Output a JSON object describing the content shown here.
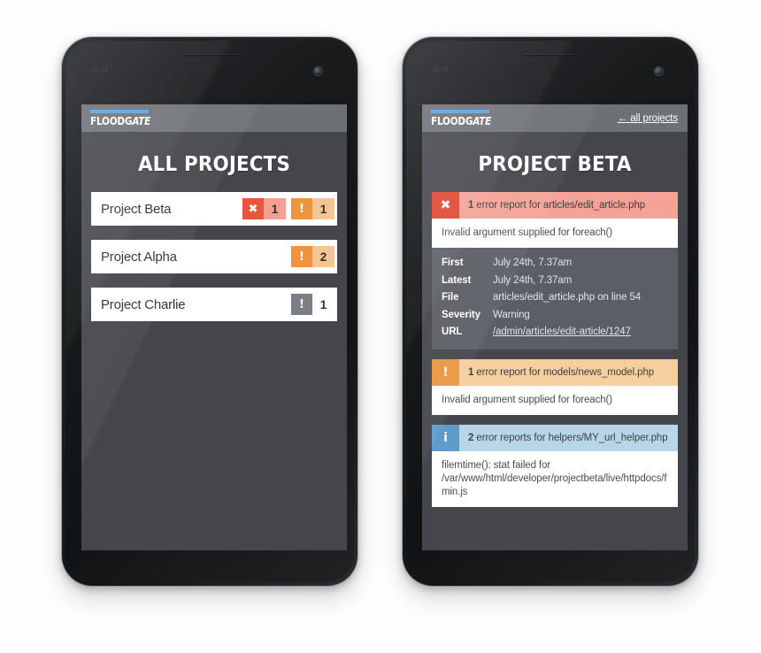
{
  "brand": {
    "logo_text_a": "FLOODG",
    "logo_text_b": "ATE",
    "logo_bar_color": "#5da2dd",
    "appbar_color": "#6d7075"
  },
  "colors": {
    "screen_bg": "#44464b",
    "error": "#e0452f",
    "warning": "#e8973f",
    "info": "#5f9cc9",
    "muted": "#7b7e84",
    "card_white": "#ffffff",
    "detail_panel": "#5b5e64"
  },
  "left_phone": {
    "title": "ALL PROJECTS",
    "projects": [
      {
        "name": "Project Beta",
        "badges": [
          {
            "severity": "error",
            "icon": "✖",
            "icon_name": "error-x-icon",
            "count": "1"
          },
          {
            "severity": "warning",
            "icon": "!",
            "icon_name": "warning-bang-icon",
            "count": "1"
          }
        ]
      },
      {
        "name": "Project Alpha",
        "badges": [
          {
            "severity": "warning",
            "icon": "!",
            "icon_name": "warning-bang-icon",
            "count": "2"
          }
        ]
      },
      {
        "name": "Project Charlie",
        "badges": [
          {
            "severity": "muted",
            "icon": "!",
            "icon_name": "warning-bang-icon",
            "count": "1"
          }
        ]
      }
    ]
  },
  "right_phone": {
    "back_link": "← all projects",
    "title": "PROJECT BETA",
    "reports": [
      {
        "severity": "error",
        "icon": "✖",
        "icon_name": "error-x-icon",
        "count": "1",
        "head_text": "error report for articles/edit_article.php",
        "message": "Invalid argument supplied for foreach()",
        "details": [
          {
            "key": "First",
            "value": "July 24th, 7.37am",
            "is_link": false
          },
          {
            "key": "Latest",
            "value": "July 24th, 7.37am",
            "is_link": false
          },
          {
            "key": "File",
            "value": "articles/edit_article.php on line 54",
            "is_link": false
          },
          {
            "key": "Severity",
            "value": "Warning",
            "is_link": false
          },
          {
            "key": "URL",
            "value": "/admin/articles/edit-article/1247",
            "is_link": true
          }
        ]
      },
      {
        "severity": "warning",
        "icon": "!",
        "icon_name": "warning-bang-icon",
        "count": "1",
        "head_text": "error report for models/news_model.php",
        "message": "Invalid argument supplied for foreach()",
        "details": []
      },
      {
        "severity": "info",
        "icon": "i",
        "icon_name": "info-i-icon",
        "count": "2",
        "head_text": "error reports for helpers/MY_url_helper.php",
        "message_line1": "filemtime(): stat failed for",
        "message_line2": "/var/www/html/developer/projectbeta/live/httpdocs/f",
        "message_line3": "min.js",
        "details": []
      }
    ]
  }
}
